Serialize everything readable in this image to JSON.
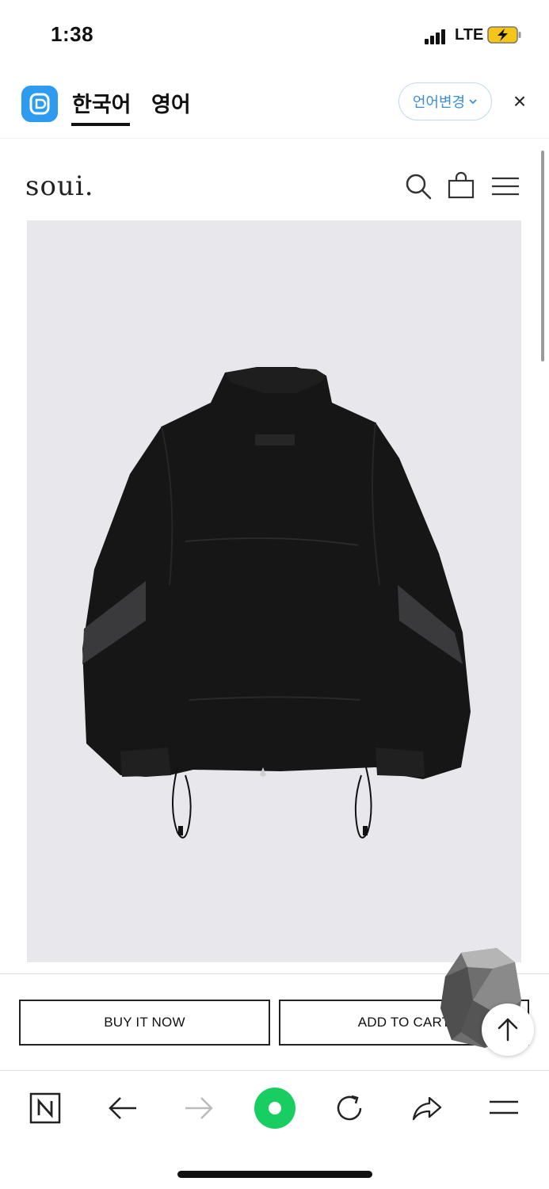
{
  "status_bar": {
    "time": "1:38",
    "network": "LTE"
  },
  "translate_bar": {
    "tab_korean": "한국어",
    "tab_english": "영어",
    "language_change": "언어변경",
    "close": "×"
  },
  "site": {
    "logo": "soui."
  },
  "actions": {
    "buy_now": "BUY IT NOW",
    "add_to_cart": "ADD TO CART"
  },
  "icons": {
    "header": [
      "search-icon",
      "shopping-bag-icon",
      "hamburger-menu-icon"
    ],
    "browser_bar": [
      "naver-n-icon",
      "back-arrow-icon",
      "forward-arrow-icon",
      "green-home-icon",
      "reload-icon",
      "share-icon",
      "menu-icon"
    ]
  },
  "colors": {
    "accent_blue": "#2c9bf0",
    "naver_green": "#19ce60",
    "image_bg": "#e8e8ec"
  }
}
